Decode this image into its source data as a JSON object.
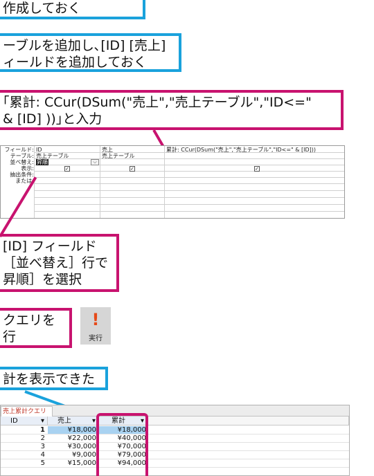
{
  "callouts": {
    "c1": "作成しておく",
    "c2_line1": "ーブルを追加し､[ID] [売上]",
    "c2_line2": "ィールドを追加しておく",
    "c3_line1": "｢累計: CCur(DSum(\"売上\",\"売上テーブル\",\"ID<=\"",
    "c3_line2": "& [ID] ))｣と入力",
    "c4_line1": "[ID] フィールド",
    "c4_line2": "［並べ替え］行で",
    "c4_line3": "昇順］を選択",
    "c5_line1": "クエリを",
    "c5_line2": "行",
    "c6": "計を表示できた"
  },
  "query_grid": {
    "row_labels": [
      "フィールド:",
      "テーブル:",
      "並べ替え:",
      "表示:",
      "抽出条件:",
      "または:"
    ],
    "col1": {
      "field": "ID",
      "table": "売上テーブル",
      "sort": "昇順",
      "show": true
    },
    "col2": {
      "field": "売上",
      "table": "売上テーブル",
      "show": true
    },
    "col3": {
      "field": "累計: CCur(DSum(\"売上\",\"売上テーブル\",\"ID<=\" & [ID]))",
      "show": true
    }
  },
  "run_button": {
    "icon": "exclamation-icon",
    "label": "実行"
  },
  "datasheet": {
    "tab": "売上累計クエリ",
    "columns": [
      "ID",
      "売上",
      "累計"
    ],
    "rows": [
      {
        "id": "1",
        "sales": "¥18,000",
        "cumulative": "¥18,000"
      },
      {
        "id": "2",
        "sales": "¥22,000",
        "cumulative": "¥40,000"
      },
      {
        "id": "3",
        "sales": "¥30,000",
        "cumulative": "¥70,000"
      },
      {
        "id": "4",
        "sales": "¥9,000",
        "cumulative": "¥79,000"
      },
      {
        "id": "5",
        "sales": "¥15,000",
        "cumulative": "¥94,000"
      }
    ]
  },
  "colors": {
    "blue": "#1aa2dc",
    "magenta": "#c8136f",
    "selection": "#a9d2f1"
  }
}
